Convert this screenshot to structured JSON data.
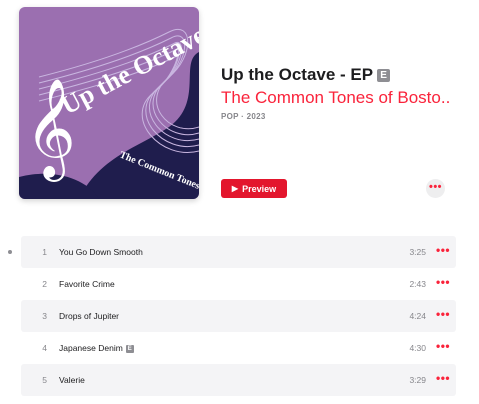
{
  "album": {
    "cover_title_text": "Up the Octave",
    "cover_artist_text": "The Common Tones",
    "title": "Up the Octave - EP",
    "explicit_badge": "E",
    "artist": "The Common Tones of Bosto...",
    "meta": "POP · 2023",
    "preview_label": "Preview",
    "more_label": "•••",
    "colors": {
      "accent": "#fa233b",
      "button": "#e3162d",
      "cover_bg": "#9b6fb0",
      "cover_dark": "#1f1d4d"
    }
  },
  "tracks": [
    {
      "number": "1",
      "name": "You Go Down Smooth",
      "explicit": "",
      "duration": "3:25",
      "more": "•••"
    },
    {
      "number": "2",
      "name": "Favorite Crime",
      "explicit": "",
      "duration": "2:43",
      "more": "•••"
    },
    {
      "number": "3",
      "name": "Drops of Jupiter",
      "explicit": "",
      "duration": "4:24",
      "more": "•••"
    },
    {
      "number": "4",
      "name": "Japanese Denim",
      "explicit": "E",
      "duration": "4:30",
      "more": "•••"
    },
    {
      "number": "5",
      "name": "Valerie",
      "explicit": "",
      "duration": "3:29",
      "more": "•••"
    }
  ]
}
